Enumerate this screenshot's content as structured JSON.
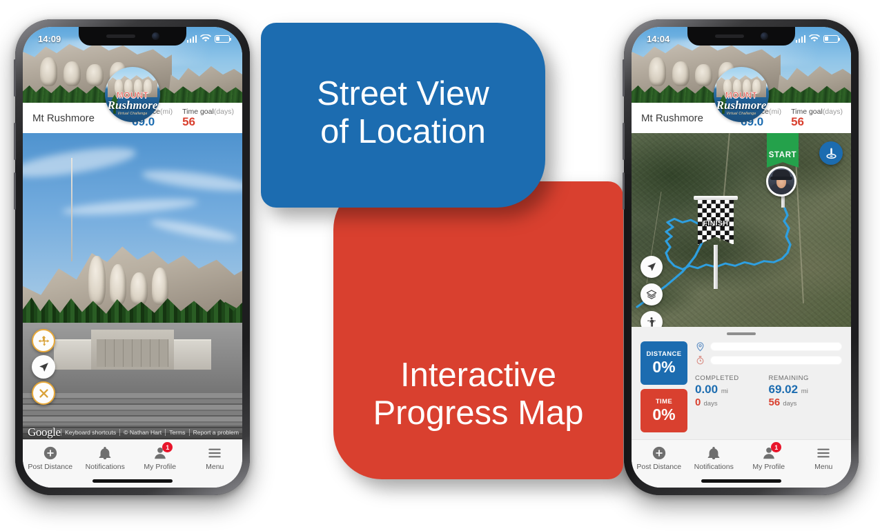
{
  "callouts": {
    "blue": {
      "line1": "Street View",
      "line2": "of Location",
      "color": "#1c6cb0"
    },
    "red": {
      "line1": "Interactive",
      "line2": "Progress Map",
      "color": "#d9402f"
    }
  },
  "phone_left": {
    "status": {
      "time": "14:09"
    },
    "header": {
      "location": "Mt Rushmore",
      "logo": {
        "top": "MOUNT",
        "main": "Rushmore",
        "sub": "Virtual Challenge"
      },
      "metrics": [
        {
          "label": "Distance",
          "unit": "(mi)",
          "value": "69.0",
          "color": "#1c6cb0"
        },
        {
          "label": "Time goal",
          "unit": "(days)",
          "value": "56",
          "color": "#d9402f"
        }
      ]
    },
    "streetview": {
      "controls": [
        {
          "icon": "pan-move-icon",
          "style": "gold"
        },
        {
          "icon": "navigate-arrow-icon",
          "style": "plain"
        },
        {
          "icon": "close-x-icon",
          "style": "gold"
        }
      ],
      "attribution": {
        "brand": "Google",
        "links": [
          "Keyboard shortcuts",
          "© Nathan Hart",
          "Terms",
          "Report a problem"
        ]
      }
    }
  },
  "phone_right": {
    "status": {
      "time": "14:04"
    },
    "header": {
      "location": "Mt Rushmore",
      "logo": {
        "top": "MOUNT",
        "main": "Rushmore",
        "sub": "Virtual Challenge"
      },
      "metrics": [
        {
          "label": "Distance",
          "unit": "(mi)",
          "value": "69.0",
          "color": "#1c6cb0"
        },
        {
          "label": "Time goal",
          "unit": "(days)",
          "value": "56",
          "color": "#d9402f"
        }
      ]
    },
    "map": {
      "start_label": "START",
      "finish_label": "FINISH",
      "route_color": "#2e9fe0",
      "badge_icon": "monument-pin-icon",
      "controls": [
        {
          "icon": "navigate-arrow-icon"
        },
        {
          "icon": "map-layers-icon"
        },
        {
          "icon": "pegman-streetview-icon"
        }
      ]
    },
    "progress": {
      "distance": {
        "label": "DISTANCE",
        "percent": "0%",
        "color": "#1c6cb0"
      },
      "time": {
        "label": "TIME",
        "percent": "0%",
        "color": "#d9402f"
      },
      "completed": {
        "heading": "COMPLETED",
        "distance_value": "0.00",
        "distance_unit": "mi",
        "days_value": "0",
        "days_unit": "days"
      },
      "remaining": {
        "heading": "REMAINING",
        "distance_value": "69.02",
        "distance_unit": "mi",
        "days_value": "56",
        "days_unit": "days"
      }
    }
  },
  "tabbar": {
    "items": [
      {
        "label": "Post Distance",
        "icon": "plus-circle-icon",
        "badge": null
      },
      {
        "label": "Notifications",
        "icon": "bell-icon",
        "badge": null
      },
      {
        "label": "My Profile",
        "icon": "person-icon",
        "badge": "1"
      },
      {
        "label": "Menu",
        "icon": "hamburger-icon",
        "badge": null
      }
    ]
  }
}
